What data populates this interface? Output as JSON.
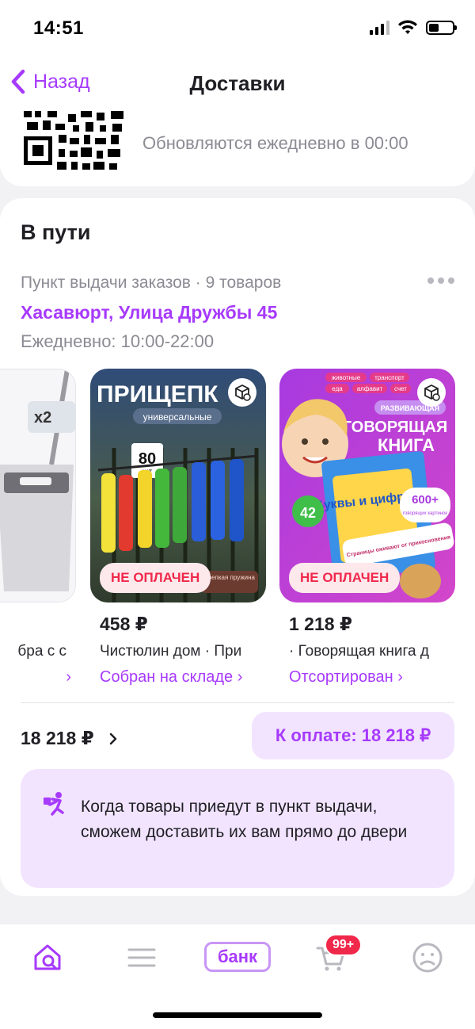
{
  "status_bar": {
    "time": "14:51"
  },
  "header": {
    "back_label": "Назад",
    "title": "Доставки"
  },
  "qr_card": {
    "note": "Обновляются ежедневно в 00:00"
  },
  "in_transit": {
    "title": "В пути",
    "meta": "Пункт выдачи заказов · 9 товаров",
    "address": "Хасавюрт, Улица Дружбы 45",
    "hours": "Ежедневно: 10:00-22:00"
  },
  "products": [
    {
      "name": "бра с с",
      "status": "›",
      "image_label": "x2"
    },
    {
      "price": "458 ₽",
      "name": "Чистюлин дом · При",
      "status": "Собран на складе ›",
      "badge": "НЕ ОПЛАЧЕН",
      "image_title": "ПРИЩЕПК",
      "image_subtitle": "универсальные",
      "image_count": "80",
      "image_count_unit": "шт",
      "image_tag": "Крепкая пружина"
    },
    {
      "price": "1 218 ₽",
      "name": "· Говорящая книга д",
      "status": "Отсортирован ›",
      "badge": "НЕ ОПЛАЧЕН",
      "image_title_line1": "ГОВОРЯЩАЯ",
      "image_title_line2": "КНИГА",
      "image_pill": "РАЗВИВАЮЩАЯ",
      "image_book": "Буквы и цифры",
      "image_count": "600+",
      "image_count_label": "говорящих картинок",
      "image_words": "42",
      "image_bottom": "Страницы оживают от прикосновения",
      "image_tags": [
        "животные",
        "транспорт",
        "еда",
        "алфавит",
        "счет"
      ]
    }
  ],
  "summary": {
    "total": "18 218 ₽",
    "pay_label": "К оплате: 18 218 ₽"
  },
  "info": {
    "text": "Когда товары приедут в пункт выдачи, сможем доставить их вам прямо до двери"
  },
  "bottom_nav": {
    "bank_label": "банк",
    "cart_badge": "99+"
  },
  "colors": {
    "accent": "#a73afd",
    "accent_light": "#f2e4ff",
    "danger": "#f0284a",
    "muted": "#8b8b94"
  }
}
